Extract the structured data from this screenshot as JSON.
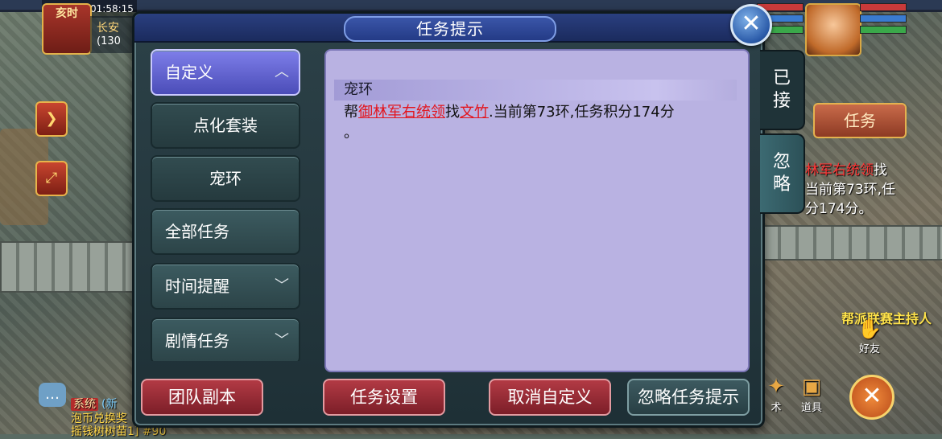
{
  "hud": {
    "clock": "01:58:15",
    "period": "亥时",
    "location": "长安",
    "location_sub": "(130"
  },
  "dialog": {
    "title": "任务提示",
    "close_label": "✕"
  },
  "categories": [
    {
      "label": "自定义",
      "state": "selected",
      "chevron": "chevron-up-icon"
    },
    {
      "label": "点化套装",
      "state": "sub"
    },
    {
      "label": "宠环",
      "state": "sub"
    },
    {
      "label": "全部任务",
      "state": "normal"
    },
    {
      "label": "时间提醒",
      "state": "normal",
      "chevron": "chevron-down-icon"
    },
    {
      "label": "剧情任务",
      "state": "normal",
      "chevron": "chevron-down-icon"
    }
  ],
  "content": {
    "header": "宠环",
    "body": {
      "prefix": "帮",
      "npc1": "御林军右统领",
      "mid": "找",
      "npc2": "文竹",
      "suffix": ".当前第73环,任务积分174分",
      "end": "。"
    }
  },
  "side_tabs": {
    "accepted": "已接",
    "ignored": "忽略"
  },
  "buttons": {
    "team_dungeon": "团队副本",
    "task_settings": "任务设置",
    "cancel_custom": "取消自定义",
    "ignore_tips": "忽略任务提示"
  },
  "right_hud": {
    "task_button": "任务",
    "quest_npc": "林军右统领",
    "quest_find": "找",
    "quest_line2": "当前第73环,任",
    "quest_line3": "分174分。",
    "npc_label": "帮派联赛主持人",
    "friend": "好友",
    "item_shop": "术",
    "item_bag": "道具"
  },
  "chat": {
    "tag": "系统",
    "tag_extra": "(新",
    "line1": "泡币兑换奖",
    "line2": "摇钱树树苗1] #90"
  }
}
